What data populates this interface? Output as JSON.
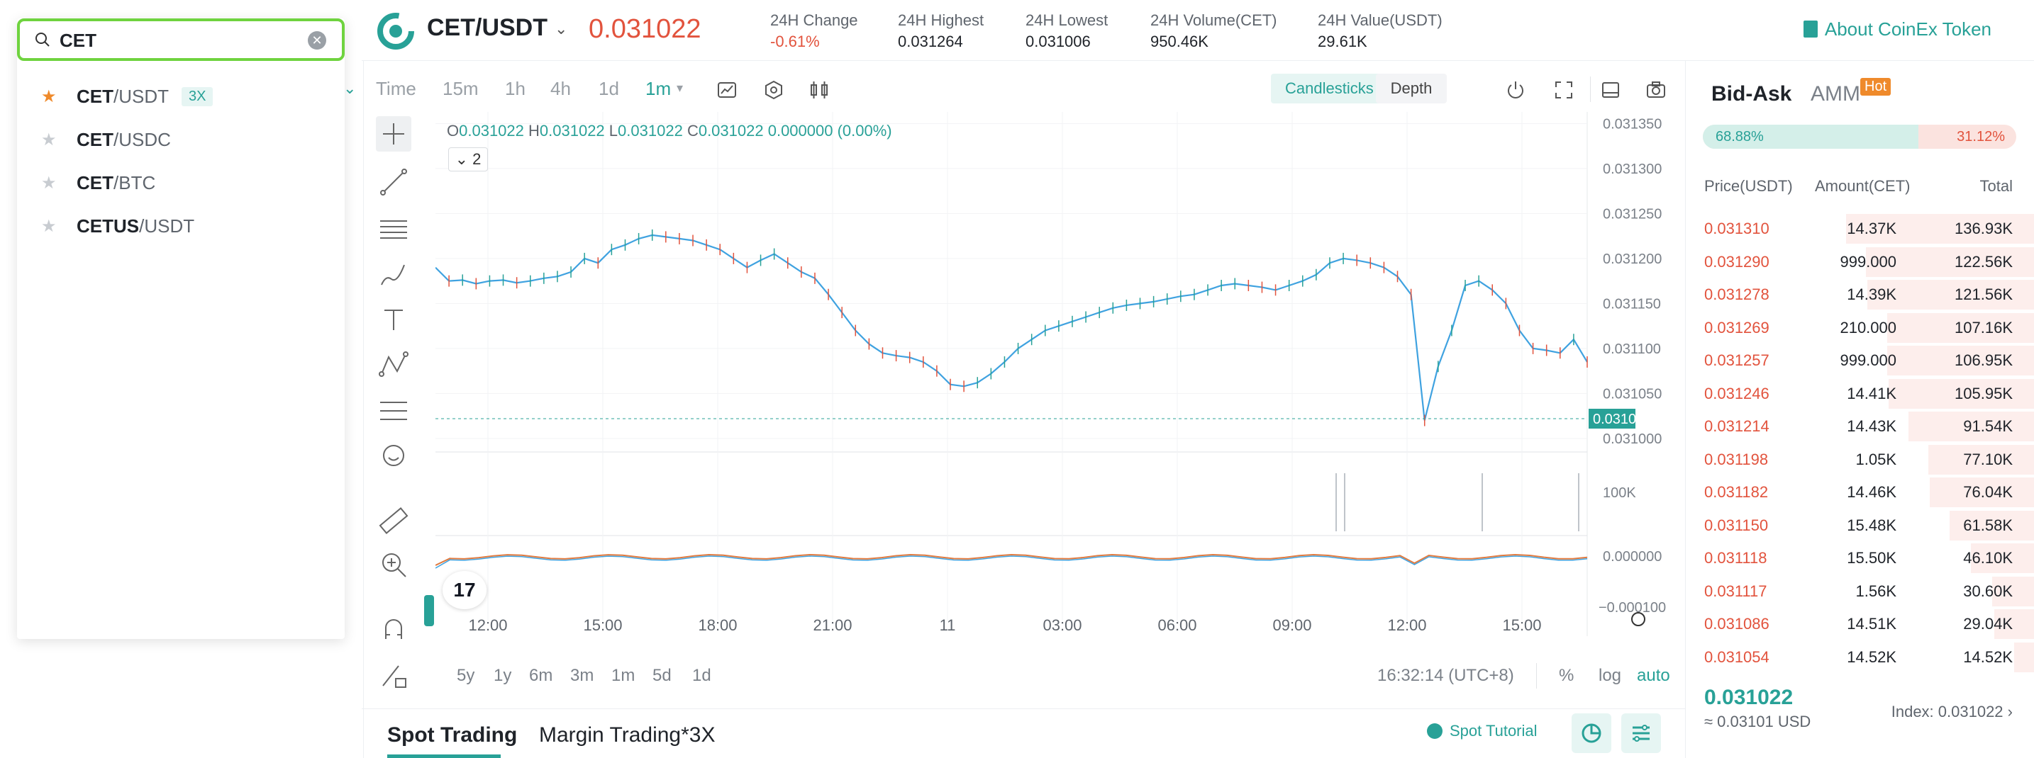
{
  "header": {
    "pair": "CET/USDT",
    "last_price": "0.031022",
    "stats": [
      {
        "label": "24H Change",
        "value": "-0.61%",
        "negative": true
      },
      {
        "label": "24H Highest",
        "value": "0.031264"
      },
      {
        "label": "24H Lowest",
        "value": "0.031006"
      },
      {
        "label": "24H Volume(CET)",
        "value": "950.46K"
      },
      {
        "label": "24H Value(USDT)",
        "value": "29.61K"
      }
    ],
    "about_link": "About CoinEx Token"
  },
  "search": {
    "value": "CET",
    "results": [
      {
        "base": "CET",
        "quote": "/USDT",
        "badge": "3X",
        "starred": true
      },
      {
        "base": "CET",
        "quote": "/USDC",
        "badge": "",
        "starred": false
      },
      {
        "base": "CET",
        "quote": "/BTC",
        "badge": "",
        "starred": false
      },
      {
        "base": "CETUS",
        "quote": "/USDT",
        "badge": "",
        "starred": false
      }
    ]
  },
  "toolbar": {
    "timeframes": [
      "Time",
      "15m",
      "1h",
      "4h",
      "1d",
      "1m"
    ],
    "active_timeframe": "1m",
    "candlesticks_label": "Candlesticks",
    "depth_label": "Depth"
  },
  "ohlc": {
    "o_label": "O",
    "o": "0.031022",
    "h_label": "H",
    "h": "0.031022",
    "l_label": "L",
    "l": "0.031022",
    "c_label": "C",
    "c": "0.031022",
    "chg": "0.000000 (0.00%)"
  },
  "indicator_toggle": "2",
  "tv_logo": "17",
  "chart_data": {
    "type": "line",
    "price_axis": [
      "0.031350",
      "0.031300",
      "0.031250",
      "0.031200",
      "0.031150",
      "0.031100",
      "0.031050",
      "0.031000"
    ],
    "price_tag": "0.031022",
    "volume_axis": [
      "100K"
    ],
    "osc_axis": [
      "0.000000",
      "−0.000100"
    ],
    "time_axis": [
      "12:00",
      "15:00",
      "18:00",
      "21:00",
      "11",
      "03:00",
      "06:00",
      "09:00",
      "12:00",
      "15:00"
    ],
    "ylim": [
      0.030985,
      0.031355
    ],
    "series": [
      {
        "values": [
          0.03119,
          0.031175,
          0.031176,
          0.031172,
          0.031175,
          0.031176,
          0.031173,
          0.031175,
          0.031178,
          0.03118,
          0.031185,
          0.0312,
          0.031195,
          0.03121,
          0.031215,
          0.031222,
          0.031226,
          0.031224,
          0.031222,
          0.03122,
          0.031215,
          0.03121,
          0.0312,
          0.03119,
          0.031198,
          0.031205,
          0.031195,
          0.031185,
          0.031178,
          0.03116,
          0.03114,
          0.03112,
          0.031105,
          0.031095,
          0.031092,
          0.03109,
          0.031085,
          0.031075,
          0.03106,
          0.031058,
          0.031062,
          0.031072,
          0.031085,
          0.0311,
          0.03111,
          0.03112,
          0.031125,
          0.03113,
          0.031135,
          0.03114,
          0.031145,
          0.031148,
          0.03115,
          0.031152,
          0.031155,
          0.031158,
          0.03116,
          0.031165,
          0.03117,
          0.031172,
          0.03117,
          0.031168,
          0.031165,
          0.03117,
          0.031175,
          0.031182,
          0.031195,
          0.0312,
          0.031198,
          0.031195,
          0.03119,
          0.03118,
          0.03116,
          0.03102,
          0.03108,
          0.03112,
          0.03117,
          0.031175,
          0.031165,
          0.03115,
          0.03112,
          0.0311,
          0.031098,
          0.031095,
          0.03111,
          0.031085
        ]
      }
    ]
  },
  "range_bar": {
    "ranges": [
      "5y",
      "1y",
      "6m",
      "3m",
      "1m",
      "5d",
      "1d"
    ],
    "clock": "16:32:14 (UTC+8)",
    "scale_options": [
      "%",
      "log",
      "auto"
    ]
  },
  "bottom_tabs": {
    "tabs": [
      "Spot Trading",
      "Margin Trading*3X"
    ],
    "tutorial": "Spot Tutorial"
  },
  "orderbook": {
    "tabs": [
      "Bid-Ask",
      "AMM"
    ],
    "hot": "Hot",
    "buy_ratio": "68.88%",
    "buy_ratio_value": 0.6888,
    "sell_ratio": "31.12%",
    "headers": {
      "price": "Price(USDT)",
      "amount": "Amount(CET)",
      "total": "Total"
    },
    "asks": [
      {
        "price": "0.031310",
        "amount": "14.37K",
        "total": "136.93K",
        "depth": 1.0
      },
      {
        "price": "0.031290",
        "amount": "999.000",
        "total": "122.56K",
        "depth": 0.895
      },
      {
        "price": "0.031278",
        "amount": "14.39K",
        "total": "121.56K",
        "depth": 0.888
      },
      {
        "price": "0.031269",
        "amount": "210.000",
        "total": "107.16K",
        "depth": 0.783
      },
      {
        "price": "0.031257",
        "amount": "999.000",
        "total": "106.95K",
        "depth": 0.781
      },
      {
        "price": "0.031246",
        "amount": "14.41K",
        "total": "105.95K",
        "depth": 0.774
      },
      {
        "price": "0.031214",
        "amount": "14.43K",
        "total": "91.54K",
        "depth": 0.669
      },
      {
        "price": "0.031198",
        "amount": "1.05K",
        "total": "77.10K",
        "depth": 0.563
      },
      {
        "price": "0.031182",
        "amount": "14.46K",
        "total": "76.04K",
        "depth": 0.555
      },
      {
        "price": "0.031150",
        "amount": "15.48K",
        "total": "61.58K",
        "depth": 0.45
      },
      {
        "price": "0.031118",
        "amount": "15.50K",
        "total": "46.10K",
        "depth": 0.337
      },
      {
        "price": "0.031117",
        "amount": "1.56K",
        "total": "30.60K",
        "depth": 0.223
      },
      {
        "price": "0.031086",
        "amount": "14.51K",
        "total": "29.04K",
        "depth": 0.212
      },
      {
        "price": "0.031054",
        "amount": "14.52K",
        "total": "14.52K",
        "depth": 0.106
      }
    ],
    "last_price": "0.031022",
    "usd_price": "≈ 0.03101 USD",
    "index": "Index: 0.031022"
  },
  "colors": {
    "accent": "#28a197",
    "down": "#e2533d",
    "highlight": "#6fd33f",
    "star": "#ef8a2b"
  }
}
